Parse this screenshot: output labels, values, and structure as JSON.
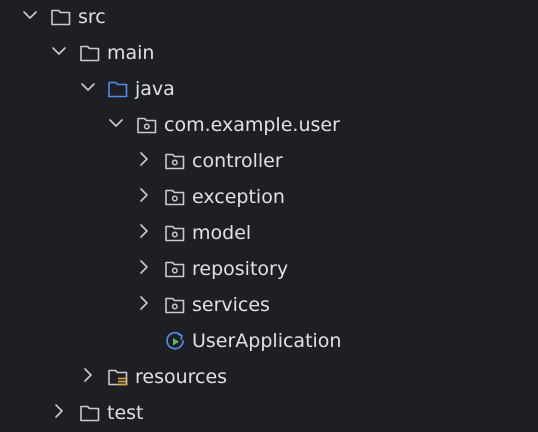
{
  "tree": {
    "src": {
      "label": "src",
      "state": "expanded",
      "icon": "folder-icon"
    },
    "main": {
      "label": "main",
      "state": "expanded",
      "icon": "folder-icon"
    },
    "java": {
      "label": "java",
      "state": "expanded",
      "icon": "source-root-folder-icon"
    },
    "package": {
      "label": "com.example.user",
      "state": "expanded",
      "icon": "package-icon"
    },
    "controller": {
      "label": "controller",
      "state": "collapsed",
      "icon": "package-icon"
    },
    "exception": {
      "label": "exception",
      "state": "collapsed",
      "icon": "package-icon"
    },
    "model": {
      "label": "model",
      "state": "collapsed",
      "icon": "package-icon"
    },
    "repository": {
      "label": "repository",
      "state": "collapsed",
      "icon": "package-icon"
    },
    "services": {
      "label": "services",
      "state": "collapsed",
      "icon": "package-icon"
    },
    "user_application": {
      "label": "UserApplication",
      "icon": "spring-boot-application-icon"
    },
    "resources": {
      "label": "resources",
      "state": "collapsed",
      "icon": "resources-folder-icon"
    },
    "test": {
      "label": "test",
      "state": "collapsed",
      "icon": "folder-icon"
    }
  },
  "colors": {
    "background": "#1e1f22",
    "text": "#dfe1e5",
    "icon_gray": "#c9cbd0",
    "arrow_gray": "#c9cbd0",
    "source_root_blue": "#4e8cf0",
    "resources_yellow": "#d9a343",
    "app_icon_blue": "#4e8cf0",
    "app_icon_green": "#5fb865"
  }
}
